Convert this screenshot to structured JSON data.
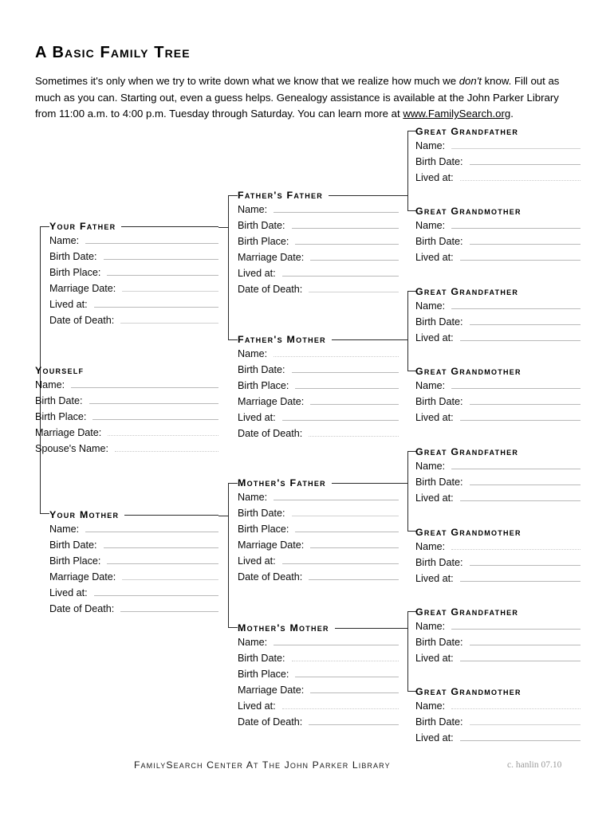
{
  "document": {
    "title": "A Basic Family Tree",
    "intro": {
      "part1": "Sometimes it's only when we try to write down what we know that we realize how much we ",
      "emphasis": "don't",
      "part2": " know.  Fill out as much as you can. Starting out, even a guess helps. Genealogy assistance is available at the John Parker Library from 11:00 a.m. to 4:00 p.m. Tuesday through Saturday. You can learn more at ",
      "link": "www.FamilySearch.org",
      "part3": "."
    }
  },
  "labels": {
    "name": "Name:",
    "birth_date": "Birth Date:",
    "birth_place": "Birth Place:",
    "marriage_date": "Marriage Date:",
    "lived_at": "Lived at:",
    "date_of_death": "Date of Death:",
    "spouse_name": "Spouse's Name:"
  },
  "blocks": {
    "self": {
      "heading": "Yourself",
      "fields": [
        "Name:",
        "Birth Date:",
        "Birth Place:",
        "Marriage Date:",
        "Spouse's Name:"
      ]
    },
    "father": {
      "heading": "Your Father",
      "fields": [
        "Name:",
        "Birth Date:",
        "Birth Place:",
        "Marriage Date:",
        "Lived at:",
        "Date of Death:"
      ]
    },
    "mother": {
      "heading": "Your Mother",
      "fields": [
        "Name:",
        "Birth Date:",
        "Birth Place:",
        "Marriage Date:",
        "Lived at:",
        "Date of Death:"
      ]
    },
    "fathers_father": {
      "heading": "Father's Father",
      "fields": [
        "Name:",
        "Birth Date:",
        "Birth Place:",
        "Marriage Date:",
        "Lived at:",
        "Date of Death:"
      ]
    },
    "fathers_mother": {
      "heading": "Father's Mother",
      "fields": [
        "Name:",
        "Birth Date:",
        "Birth Place:",
        "Marriage Date:",
        "Lived at:",
        "Date of Death:"
      ]
    },
    "mothers_father": {
      "heading": "Mother's Father",
      "fields": [
        "Name:",
        "Birth Date:",
        "Birth Place:",
        "Marriage Date:",
        "Lived at:",
        "Date of Death:"
      ]
    },
    "mothers_mother": {
      "heading": "Mother's Mother",
      "fields": [
        "Name:",
        "Birth Date:",
        "Birth Place:",
        "Marriage Date:",
        "Lived at:",
        "Date of Death:"
      ]
    },
    "great_grandparents": [
      {
        "heading": "Great Grandfather",
        "fields": [
          "Name:",
          "Birth Date:",
          "Lived at:"
        ]
      },
      {
        "heading": "Great Grandmother",
        "fields": [
          "Name:",
          "Birth Date:",
          "Lived at:"
        ]
      },
      {
        "heading": "Great Grandfather",
        "fields": [
          "Name:",
          "Birth Date:",
          "Lived at:"
        ]
      },
      {
        "heading": "Great Grandmother",
        "fields": [
          "Name:",
          "Birth Date:",
          "Lived at:"
        ]
      },
      {
        "heading": "Great Grandfather",
        "fields": [
          "Name:",
          "Birth Date:",
          "Lived at:"
        ]
      },
      {
        "heading": "Great Grandmother",
        "fields": [
          "Name:",
          "Birth Date:",
          "Lived at:"
        ]
      },
      {
        "heading": "Great Grandfather",
        "fields": [
          "Name:",
          "Birth Date:",
          "Lived at:"
        ]
      },
      {
        "heading": "Great Grandmother",
        "fields": [
          "Name:",
          "Birth Date:",
          "Lived at:"
        ]
      }
    ]
  },
  "footer": {
    "organization": "FamilySearch Center at the John Parker Library",
    "credit": "c. hanlin 07.10"
  },
  "colors": {
    "ink": "#111111",
    "rule": "#2b2b2b",
    "blank_line": "#b9b9b9",
    "credit": "#9a9a9a"
  }
}
